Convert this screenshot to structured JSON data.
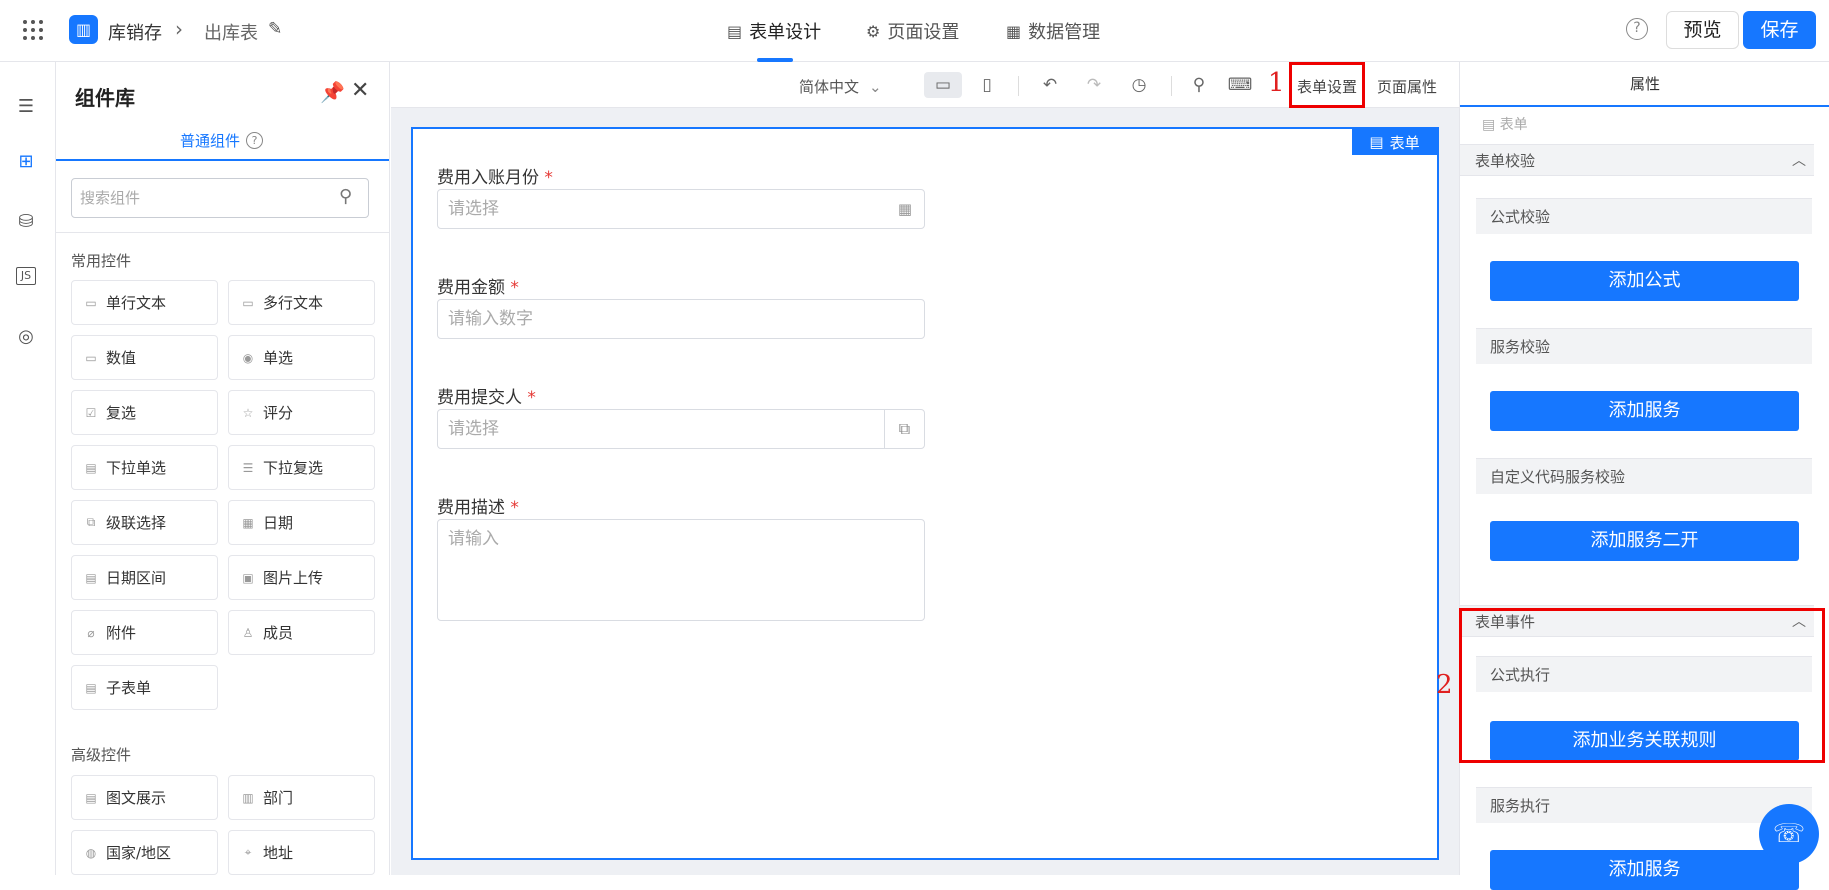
{
  "topbar": {
    "app_name": "库销存",
    "page_name": "出库表",
    "tabs": [
      {
        "label": "表单设计",
        "icon": "document-icon"
      },
      {
        "label": "页面设置",
        "icon": "gear-icon"
      },
      {
        "label": "数据管理",
        "icon": "grid-icon"
      }
    ],
    "preview_label": "预览",
    "save_label": "保存"
  },
  "library": {
    "title": "组件库",
    "tab": "普通组件",
    "search_placeholder": "搜索组件",
    "common_title": "常用控件",
    "common": [
      "单行文本",
      "多行文本",
      "数值",
      "单选",
      "复选",
      "评分",
      "下拉单选",
      "下拉复选",
      "级联选择",
      "日期",
      "日期区间",
      "图片上传",
      "附件",
      "成员",
      "子表单"
    ],
    "advanced_title": "高级控件",
    "advanced": [
      "图文展示",
      "部门",
      "国家/地区",
      "地址"
    ]
  },
  "toolbar": {
    "language": "简体中文",
    "annotation_1": "1",
    "form_settings": "表单设置",
    "page_properties": "页面属性"
  },
  "form": {
    "tag": "表单",
    "fields": [
      {
        "label": "费用入账月份",
        "required": "*",
        "placeholder": "请选择"
      },
      {
        "label": "费用金额",
        "required": "*",
        "placeholder": "请输入数字"
      },
      {
        "label": "费用提交人",
        "required": "*",
        "placeholder": "请选择"
      },
      {
        "label": "费用描述",
        "required": "*",
        "placeholder": "请输入"
      }
    ]
  },
  "props": {
    "title": "属性",
    "form_label": "表单",
    "validation_title": "表单校验",
    "formula_check": "公式校验",
    "add_formula": "添加公式",
    "service_check": "服务校验",
    "add_service": "添加服务",
    "custom_check": "自定义代码服务校验",
    "add_service_dev": "添加服务二开",
    "events_title": "表单事件",
    "formula_exec": "公式执行",
    "add_rule": "添加业务关联规则",
    "service_exec": "服务执行",
    "add_service_2": "添加服务",
    "annotation_2": "2"
  }
}
